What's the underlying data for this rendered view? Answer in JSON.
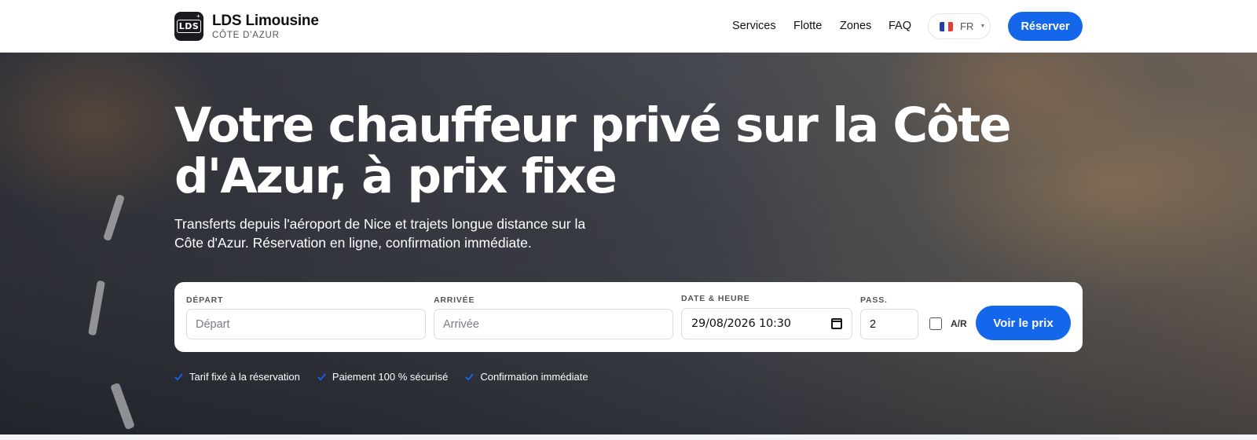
{
  "brand": {
    "logo_text": "LDS",
    "name": "LDS Limousine",
    "tagline": "CÔTE D'AZUR"
  },
  "nav": {
    "items": [
      {
        "label": "Services"
      },
      {
        "label": "Flotte"
      },
      {
        "label": "Zones"
      },
      {
        "label": "FAQ"
      }
    ],
    "language": {
      "code": "FR",
      "flag_colors": [
        "#1f3fa8",
        "#ffffff",
        "#e23b3b"
      ]
    },
    "reserve_label": "Réserver"
  },
  "hero": {
    "title": "Votre chauffeur privé sur la Côte d'Azur, à prix fixe",
    "subtitle": "Transferts depuis l'aéroport de Nice et trajets longue distance sur la Côte d'Azur. Réservation en ligne, confirmation immédiate."
  },
  "booking": {
    "departure": {
      "label": "DÉPART",
      "placeholder": "Départ",
      "value": ""
    },
    "arrival": {
      "label": "ARRIVÉE",
      "placeholder": "Arrivée",
      "value": ""
    },
    "datetime": {
      "label": "DATE & HEURE",
      "value": "29/08/2026 10:30"
    },
    "passengers": {
      "label": "PASS.",
      "value": "2"
    },
    "round_trip": {
      "label": "A/R",
      "checked": false
    },
    "submit_label": "Voir le prix"
  },
  "features": [
    {
      "label": "Tarif fixé à la réservation"
    },
    {
      "label": "Paiement 100 % sécurisé"
    },
    {
      "label": "Confirmation immédiate"
    }
  ],
  "colors": {
    "accent": "#1466ea",
    "check": "#1466ea"
  }
}
